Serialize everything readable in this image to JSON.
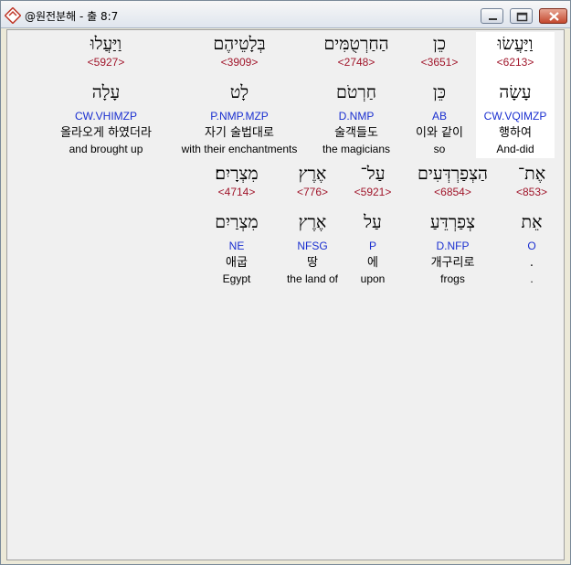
{
  "window": {
    "title": "@원전분해 - 출 8:7"
  },
  "rows": [
    {
      "words": [
        {
          "hebrew": "וַיַּעֲשׂוּ",
          "strong": "<6213>",
          "root": "עָשָׂה",
          "morph": "CW.VQIMZP",
          "korean": "행하여",
          "english": "And-did",
          "selected": true
        },
        {
          "hebrew": "כֵן",
          "strong": "<3651>",
          "root": "כֵּן",
          "morph": "AB",
          "korean": "이와 같이",
          "english": "so"
        },
        {
          "hebrew": "הַחַרְטֻמִּים",
          "strong": "<2748>",
          "root": "חַרְטֹם",
          "morph": "D.NMP",
          "korean": "술객들도",
          "english": "the magicians"
        },
        {
          "hebrew": "בְּלָטֵיהֶם",
          "strong": "<3909>",
          "root": "לָט",
          "morph": "P.NMP.MZP",
          "korean": "자기 술법대로",
          "english": "with their enchantments"
        },
        {
          "hebrew": "וַיַּעֲלוּ",
          "strong": "<5927>",
          "root": "עָלָה",
          "morph": "CW.VHIMZP",
          "korean": "올라오게 하였더라",
          "english": "and brought up"
        }
      ]
    },
    {
      "words": [
        {
          "hebrew": "אֶת־",
          "strong": "<853>",
          "root": "אֵת",
          "morph": "O",
          "korean": ".",
          "english": "."
        },
        {
          "hebrew": "הַצְפַרְדְּעִים",
          "strong": "<6854>",
          "root": "צְפַרְדֵּעַ",
          "morph": "D.NFP",
          "korean": "개구리로",
          "english": "frogs"
        },
        {
          "hebrew": "עַל־",
          "strong": "<5921>",
          "root": "עַל",
          "morph": "P",
          "korean": "에",
          "english": "upon"
        },
        {
          "hebrew": "אֶרֶץ",
          "strong": "<776>",
          "root": "אֶרֶץ",
          "morph": "NFSG",
          "korean": "땅",
          "english": "the land of"
        },
        {
          "hebrew": "מִצְרָיִם׃",
          "strong": "<4714>",
          "root": "מִצְרַיִם",
          "morph": "NE",
          "korean": "애굽",
          "english": "Egypt"
        }
      ]
    }
  ]
}
